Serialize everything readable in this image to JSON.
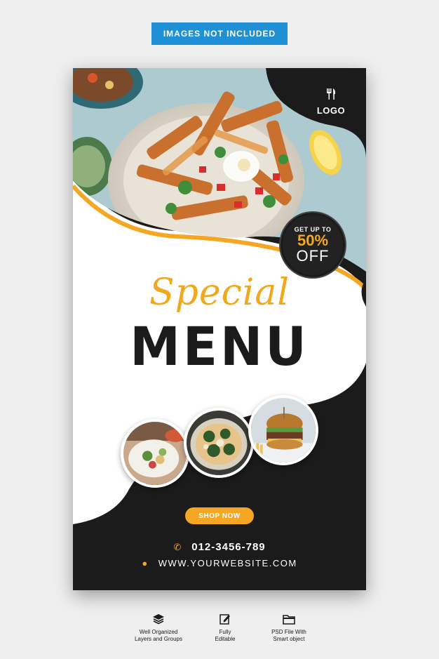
{
  "banner": {
    "label": "IMAGES NOT INCLUDED"
  },
  "poster": {
    "logo": {
      "icon": "fork-knife-icon",
      "text": "LOGO"
    },
    "discount": {
      "line1": "GET UP TO",
      "line2": "50%",
      "line3": "OFF"
    },
    "headline": {
      "script": "Special",
      "main": "MENU"
    },
    "cta": {
      "label": "SHOP NOW"
    },
    "contact": {
      "phone_icon": "phone-icon",
      "phone": "012-3456-789",
      "web_icon": "globe-icon",
      "website": "WWW.YOURWEBSITE.COM"
    },
    "colors": {
      "accent": "#f5a623",
      "dark": "#1b1b1b",
      "light": "#ffffff"
    }
  },
  "features": [
    {
      "icon": "layers-icon",
      "line1": "Well Organized",
      "line2": "Layers and Groups"
    },
    {
      "icon": "edit-icon",
      "line1": "Fully",
      "line2": "Editable"
    },
    {
      "icon": "folder-icon",
      "line1": "PSD File With",
      "line2": "Smart object"
    }
  ]
}
